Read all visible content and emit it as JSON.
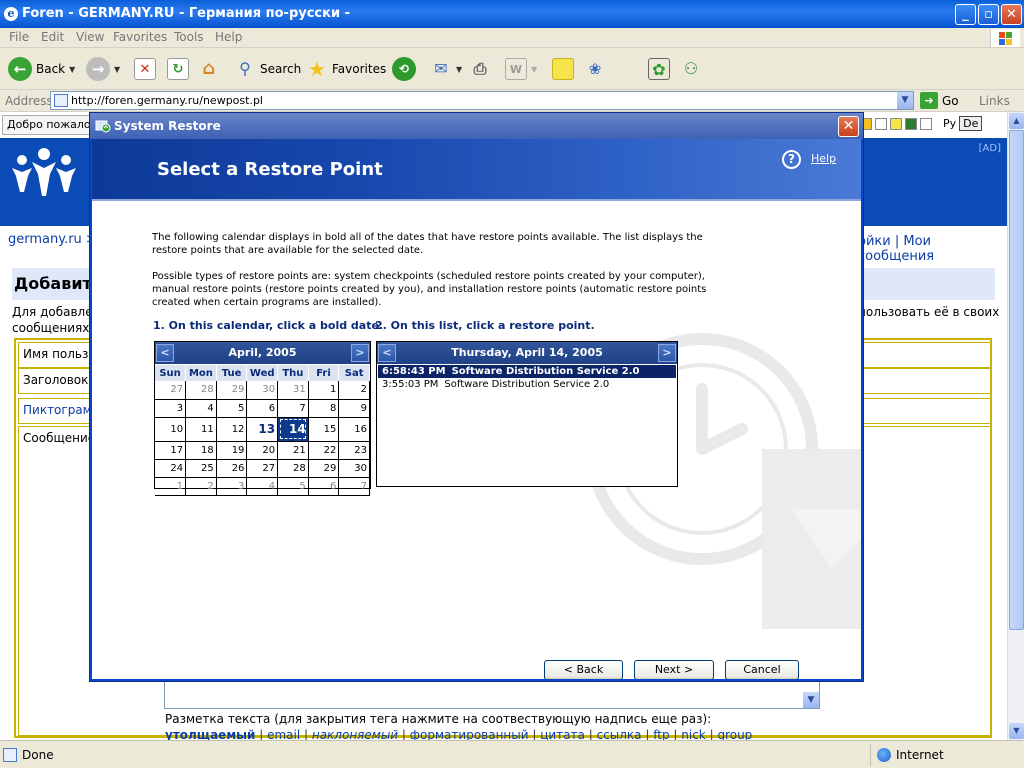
{
  "browser": {
    "title": "Foren - GERMANY.RU - Германия по-русски -",
    "window_controls": {
      "minimize": "_",
      "maximize": "▫",
      "close": "✕"
    },
    "menu": [
      "File",
      "Edit",
      "View",
      "Favorites",
      "Tools",
      "Help"
    ],
    "toolbar": {
      "back": "Back",
      "search": "Search",
      "favorites": "Favorites"
    },
    "address": {
      "label": "Address",
      "url": "http://foren.germany.ru/newpost.pl",
      "go": "Go",
      "links": "Links"
    }
  },
  "webpage": {
    "tab": "Добро пожаловать",
    "lang_ru": "Ру",
    "lang_de": "De",
    "ad_label": "[AD]",
    "breadcrumb": "germany.ru >",
    "nav_right": "ойки | Мои сообщения",
    "heading": "Добавить",
    "desc_left_1": "Для добавле",
    "desc_left_2": "сообщениях.",
    "desc_right": "пользовать её в своих",
    "form_rows": [
      "Имя пользо",
      "Заголовок",
      "Пиктограмм",
      "Сообщение"
    ],
    "markup_hint": "Разметка текста (для закрытия тега нажмите на соотвествующую надпись еще раз):",
    "markup_links": [
      "утолщаемый",
      "email",
      "наклоняемый",
      "форматированный",
      "цитата",
      "ссылка",
      "ftp",
      "nick",
      "group"
    ]
  },
  "statusbar": {
    "status": "Done",
    "zone": "Internet"
  },
  "dialog": {
    "title": "System Restore",
    "heading": "Select a Restore Point",
    "help": "Help",
    "paragraph1": "The following calendar displays in bold all of the dates that have restore points available. The list displays the restore points that are available for the selected date.",
    "paragraph2": "Possible types of restore points are: system checkpoints (scheduled restore points created by your computer), manual restore points (restore points created by you), and installation restore points (automatic restore points created when certain programs are installed).",
    "step1": "1. On this calendar, click a bold date.",
    "step2": "2. On this list, click a restore point.",
    "calendar": {
      "month": "April, 2005",
      "prev": "<",
      "next": ">",
      "weekdays": [
        "Sun",
        "Mon",
        "Tue",
        "Wed",
        "Thu",
        "Fri",
        "Sat"
      ],
      "weeks": [
        [
          "27",
          "28",
          "29",
          "30",
          "31",
          "1",
          "2"
        ],
        [
          "3",
          "4",
          "5",
          "6",
          "7",
          "8",
          "9"
        ],
        [
          "10",
          "11",
          "12",
          "13",
          "14",
          "15",
          "16"
        ],
        [
          "17",
          "18",
          "19",
          "20",
          "21",
          "22",
          "23"
        ],
        [
          "24",
          "25",
          "26",
          "27",
          "28",
          "29",
          "30"
        ],
        [
          "1",
          "2",
          "3",
          "4",
          "5",
          "6",
          "7"
        ]
      ],
      "bold_dates": [
        "13"
      ],
      "selected_date": "14"
    },
    "list": {
      "date": "Thursday, April 14, 2005",
      "prev": "<",
      "next": ">",
      "items": [
        {
          "time": "6:58:43 PM",
          "name": "Software Distribution Service 2.0",
          "selected": true
        },
        {
          "time": "3:55:03 PM",
          "name": "Software Distribution Service 2.0",
          "selected": false
        }
      ]
    },
    "buttons": {
      "back": "< Back",
      "next": "Next >",
      "cancel": "Cancel"
    }
  }
}
